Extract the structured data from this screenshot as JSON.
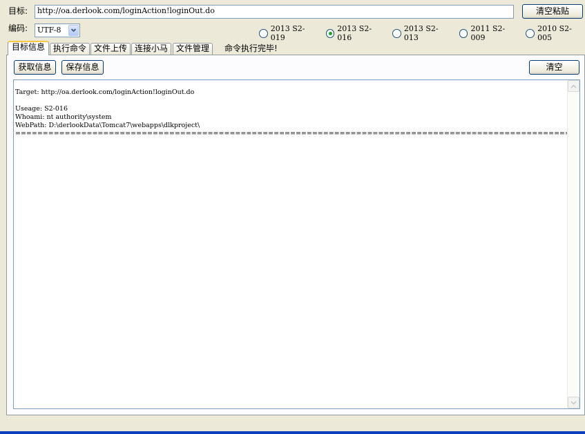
{
  "target": {
    "label": "目标:",
    "value": "http://oa.derlook.com/loginAction!loginOut.do",
    "clear_paste_label": "清空粘贴"
  },
  "encoding": {
    "label": "编码:",
    "selected": "UTF-8"
  },
  "exploits": [
    {
      "label": "2013 S2-019",
      "checked": false
    },
    {
      "label": "2013 S2-016",
      "checked": true
    },
    {
      "label": "2013 S2-013",
      "checked": false
    },
    {
      "label": "2011 S2-009",
      "checked": false
    },
    {
      "label": "2010 S2-005",
      "checked": false
    }
  ],
  "tabs": [
    {
      "label": "目标信息",
      "active": true
    },
    {
      "label": "执行命令",
      "active": false
    },
    {
      "label": "文件上传",
      "active": false
    },
    {
      "label": "连接小马",
      "active": false
    },
    {
      "label": "文件管理",
      "active": false
    }
  ],
  "status": "命令执行完毕!",
  "buttons": {
    "get_info": "获取信息",
    "save_info": "保存信息",
    "clear": "清空"
  },
  "output": "Target: http://oa.derlook.com/loginAction!loginOut.do\n\nUseage: S2-016\nWhoami: nt authority\\system\nWebPath: D:\\derlookData\\Tomcat7\\webapps\\dlkproject\\\n===================================================================================================================================="
}
